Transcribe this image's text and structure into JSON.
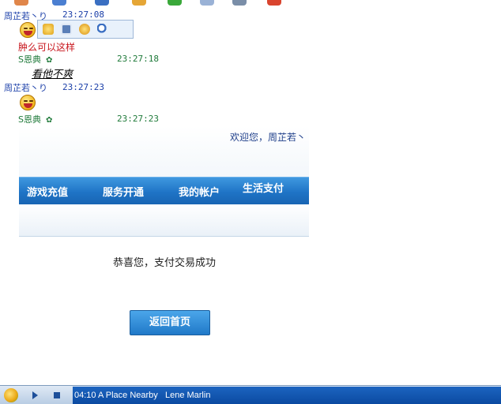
{
  "chat": {
    "messages": [
      {
        "sender": "周芷若丶り",
        "time": "23:27:08"
      },
      {
        "sender": "S恩典",
        "star": "✿",
        "time": "23:27:18",
        "text": "肿么可以这样"
      },
      {
        "sender": "周芷若丶り",
        "time": "23:27:23",
        "text": "看他不爽"
      },
      {
        "sender": "S恩典",
        "star": "✿",
        "time": "23:27:23"
      }
    ],
    "toolbar_icons": [
      "add-emoticon-icon",
      "save-icon",
      "emoticon-manage-icon",
      "search-icon"
    ]
  },
  "embedded_page": {
    "welcome": "欢迎您，周芷若丶",
    "nav": [
      "游戏充值",
      "服务开通",
      "我的帐户",
      "生活支付"
    ],
    "success_message": "恭喜您，支付交易成功",
    "return_button": "返回首页"
  },
  "player": {
    "track": "04:10 A Place Nearby   Lene Marlin"
  },
  "colors": {
    "accent": "#1f74c6",
    "sender_blue": "#1a3ea8",
    "sender_green": "#1f7a3a",
    "red_text": "#c8161d"
  }
}
